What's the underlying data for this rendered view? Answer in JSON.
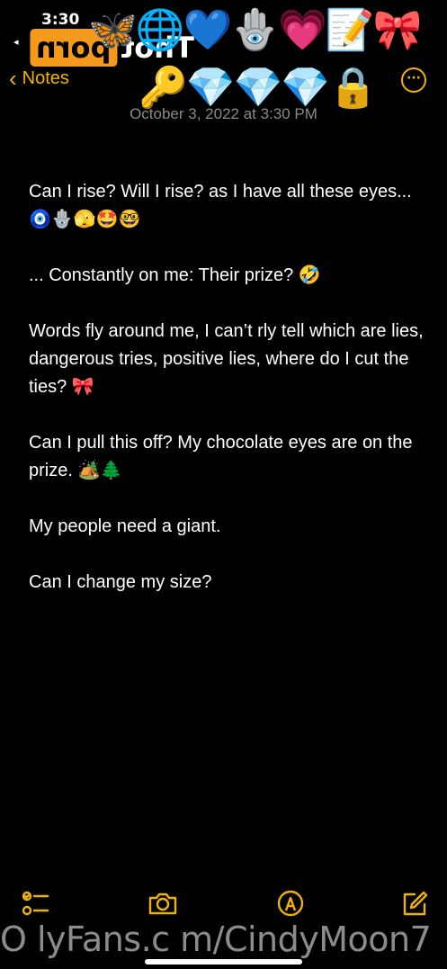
{
  "status_bar": {
    "time": "3:30",
    "back_app_caret": "◂"
  },
  "watermark": {
    "logo_box": "porn",
    "logo_rest": "Thot",
    "url": "O lyFans.c m/CindyMoon7"
  },
  "emoji_overlay": {
    "row1": "🦋🌐💙🪬💗📝🎀",
    "row2": "🔑💎💎💎🔒"
  },
  "nav": {
    "back_label": "Notes",
    "more_icon": "ellipsis-circle-icon"
  },
  "note": {
    "date": "October 3, 2022 at 3:30 PM",
    "paragraphs": [
      "Can I rise? Will I rise? as I have all these eyes... 🧿🪬🫣🤩🤓",
      "... Constantly on me: Their prize? 🤣",
      "Words fly around me, I can’t rly tell which are lies, dangerous tries, positive lies, where do I cut the ties? 🎀",
      "Can I pull this off? My chocolate eyes are on the prize. 🏕️🌲",
      "My people need a giant.",
      "Can I change my size?"
    ]
  },
  "toolbar": {
    "icons": [
      "checklist-icon",
      "camera-icon",
      "markup-pen-icon",
      "compose-icon"
    ]
  },
  "colors": {
    "accent": "#f0b400",
    "background": "#000000",
    "date_text": "#8a8a8e",
    "logo_orange": "#f59a1a"
  }
}
